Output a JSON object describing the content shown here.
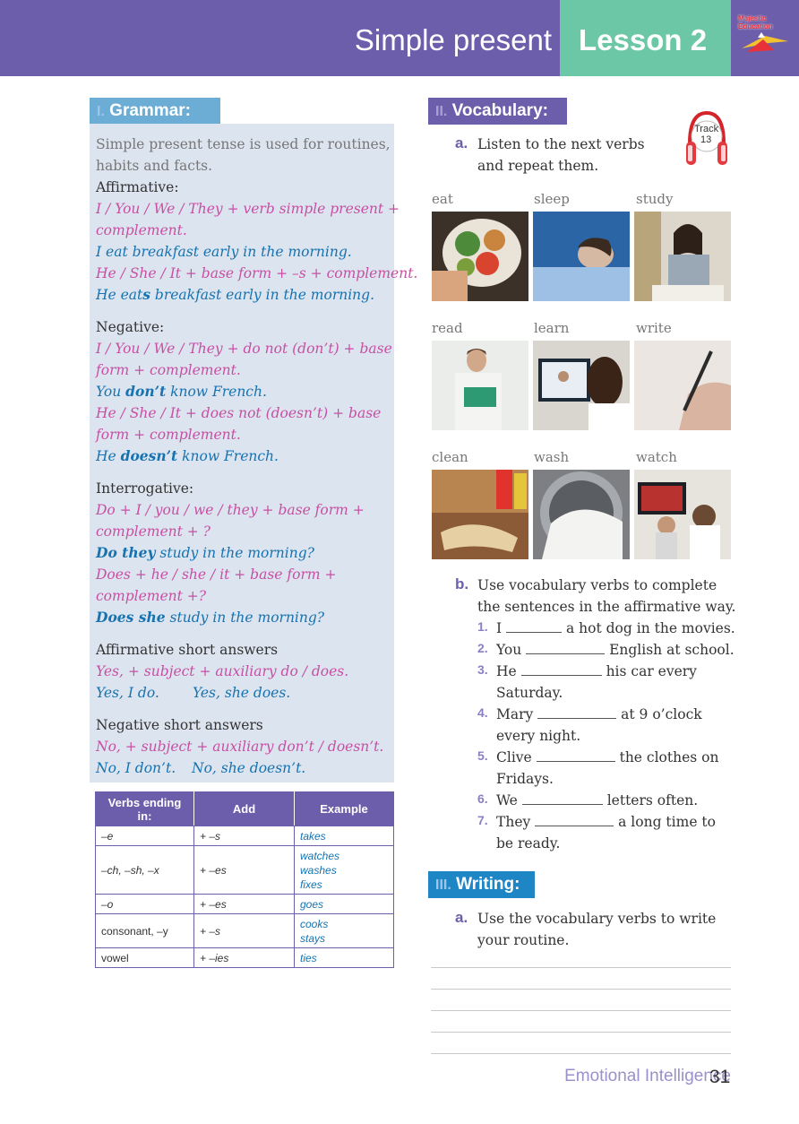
{
  "header": {
    "title": "Simple present",
    "lesson": "Lesson 2",
    "logo_line1": "Majestic",
    "logo_line2": "Education"
  },
  "grammar": {
    "number": "I.",
    "label": "Grammar:",
    "intro1": "Simple present tense is used for routines,",
    "intro2": "habits and facts.",
    "affirmative": "Affirmative:",
    "aff_rule1": "I / You / We / They + verb simple present +",
    "aff_rule2": "complement.",
    "aff_ex1": "I eat breakfast early in the morning.",
    "aff_rule3": "He / She / It + base form + –s + complement.",
    "aff_ex2_a": "He eat",
    "aff_ex2_b": "s",
    "aff_ex2_c": " breakfast early in the morning.",
    "negative": "Negative:",
    "neg_rule1": "I / You / We / They + do not (don’t) + base",
    "neg_rule2": "form + complement.",
    "neg_ex1_a": "You ",
    "neg_ex1_b": "don’t",
    "neg_ex1_c": " know French.",
    "neg_rule3": "He / She / It + does not (doesn’t) + base",
    "neg_rule4": "form + complement.",
    "neg_ex2_a": "He ",
    "neg_ex2_b": "doesn’t",
    "neg_ex2_c": " know French.",
    "interrogative": "Interrogative:",
    "int_rule1": "Do + I / you / we / they + base form +",
    "int_rule2": "complement + ?",
    "int_ex1_a": "Do they",
    "int_ex1_b": " study in the morning?",
    "int_rule3": "Does + he / she / it + base form +",
    "int_rule4": "complement +?",
    "int_ex2_a": "Does she",
    "int_ex2_b": " study in the morning?",
    "aff_short": "Affirmative short answers",
    "aff_short_rule": "Yes, + subject + auxiliary do / does.",
    "aff_short_ex1": "Yes, I do.",
    "aff_short_ex2": "Yes, she does.",
    "neg_short": "Negative short answers",
    "neg_short_rule": "No, + subject + auxiliary don’t / doesn’t.",
    "neg_short_ex1": "No, I don’t.",
    "neg_short_ex2": "No, she doesn’t."
  },
  "table": {
    "headers": [
      "Verbs ending in:",
      "Add",
      "Example"
    ],
    "rows": [
      {
        "ending": "–e",
        "add": "+ –s",
        "example": [
          "takes"
        ]
      },
      {
        "ending": "–ch, –sh, –x",
        "add": "+ –es",
        "example": [
          "watches",
          "washes",
          "fixes"
        ]
      },
      {
        "ending": "–o",
        "add": "+ –es",
        "example": [
          "goes"
        ]
      },
      {
        "ending": "consonant, –y",
        "add": "+ –s",
        "example": [
          "cooks",
          "stays"
        ]
      },
      {
        "ending": "vowel",
        "add": "+ –ies",
        "example": [
          "ties"
        ]
      }
    ]
  },
  "vocabulary": {
    "number": "II.",
    "label": "Vocabulary:",
    "a_letter": "a.",
    "a_line1": "Listen to the next verbs",
    "a_line2": "and repeat them.",
    "track_label": "Track",
    "track_num": "13",
    "words": [
      "eat",
      "sleep",
      "study",
      "read",
      "learn",
      "write",
      "clean",
      "wash",
      "watch"
    ],
    "b_letter": "b.",
    "b_line1": "Use vocabulary verbs to complete",
    "b_line2": "the sentences in the affirmative way.",
    "sentences": [
      {
        "n": "1.",
        "pre": "I",
        "post": "a hot dog in the movies.",
        "cont": ""
      },
      {
        "n": "2.",
        "pre": "You",
        "post": "English at school.",
        "cont": ""
      },
      {
        "n": "3.",
        "pre": "He",
        "post": "his car every",
        "cont": "Saturday."
      },
      {
        "n": "4.",
        "pre": "Mary",
        "post": "at 9 o’clock",
        "cont": "every night."
      },
      {
        "n": "5.",
        "pre": "Clive",
        "post": "the clothes on",
        "cont": "Fridays."
      },
      {
        "n": "6.",
        "pre": "We",
        "post": "letters often.",
        "cont": ""
      },
      {
        "n": "7.",
        "pre": "They",
        "post": "a long time to",
        "cont": "be ready."
      }
    ]
  },
  "writing": {
    "number": "III.",
    "label": "Writing:",
    "a_letter": "a.",
    "a_line1": "Use the vocabulary verbs to write",
    "a_line2": "your routine."
  },
  "footer": {
    "text": "Emotional Intelligence",
    "page": "31"
  },
  "colors": {
    "purple": "#6d5eab",
    "teal": "#6cc7a6",
    "blue": "#1672b0",
    "pink": "#c74fa3",
    "panel": "#dce5ef"
  }
}
